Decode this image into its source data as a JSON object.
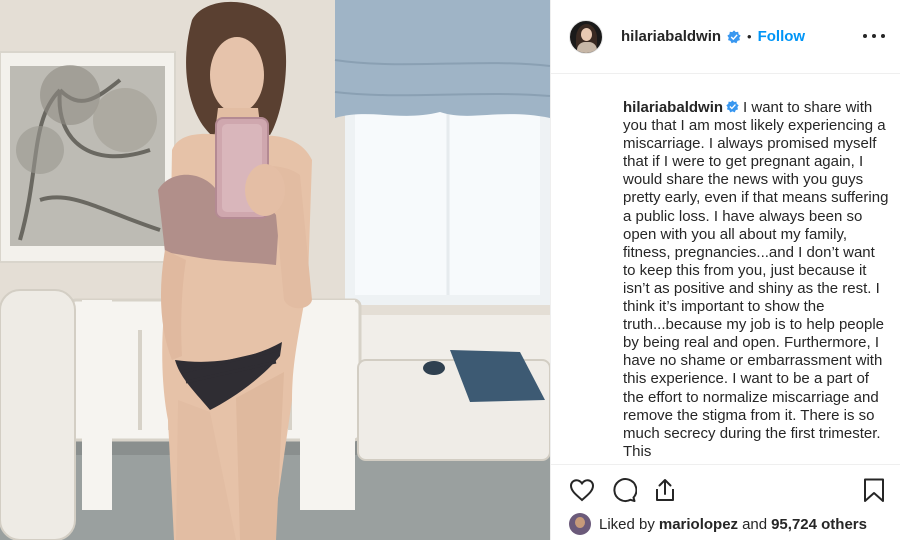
{
  "post": {
    "username": "hilariabaldwin",
    "separator": "•",
    "follow_label": "Follow",
    "caption": "I want to share with you that I am most likely experiencing a miscarriage. I always promised myself that if I were to get pregnant again, I would share the news with you guys pretty early, even if that means suffering a public loss. I have always been so open with you all about my family, fitness, pregnancies...and I don’t want to keep this from you, just because it isn’t as positive and shiny as the rest. I think it’s important to show the truth...because my job is to help people by being real and open. Furthermore, I have no shame or embarrassment with this experience. I want to be a part of the effort to normalize miscarriage and remove the stigma from it. There is so much secrecy during the first trimester. This",
    "liked_by_prefix": "Liked by",
    "liked_by_user": "mariolopez",
    "liked_by_and": "and",
    "liked_by_count": "95,724 others"
  },
  "icons": {
    "verified": "verified-badge-icon",
    "more": "more-options-icon",
    "like": "heart-icon",
    "comment": "comment-icon",
    "share": "share-icon",
    "save": "bookmark-icon"
  },
  "colors": {
    "verified": "#3897f0",
    "follow": "#0095f6",
    "text": "#262626",
    "divider": "#efefef"
  }
}
